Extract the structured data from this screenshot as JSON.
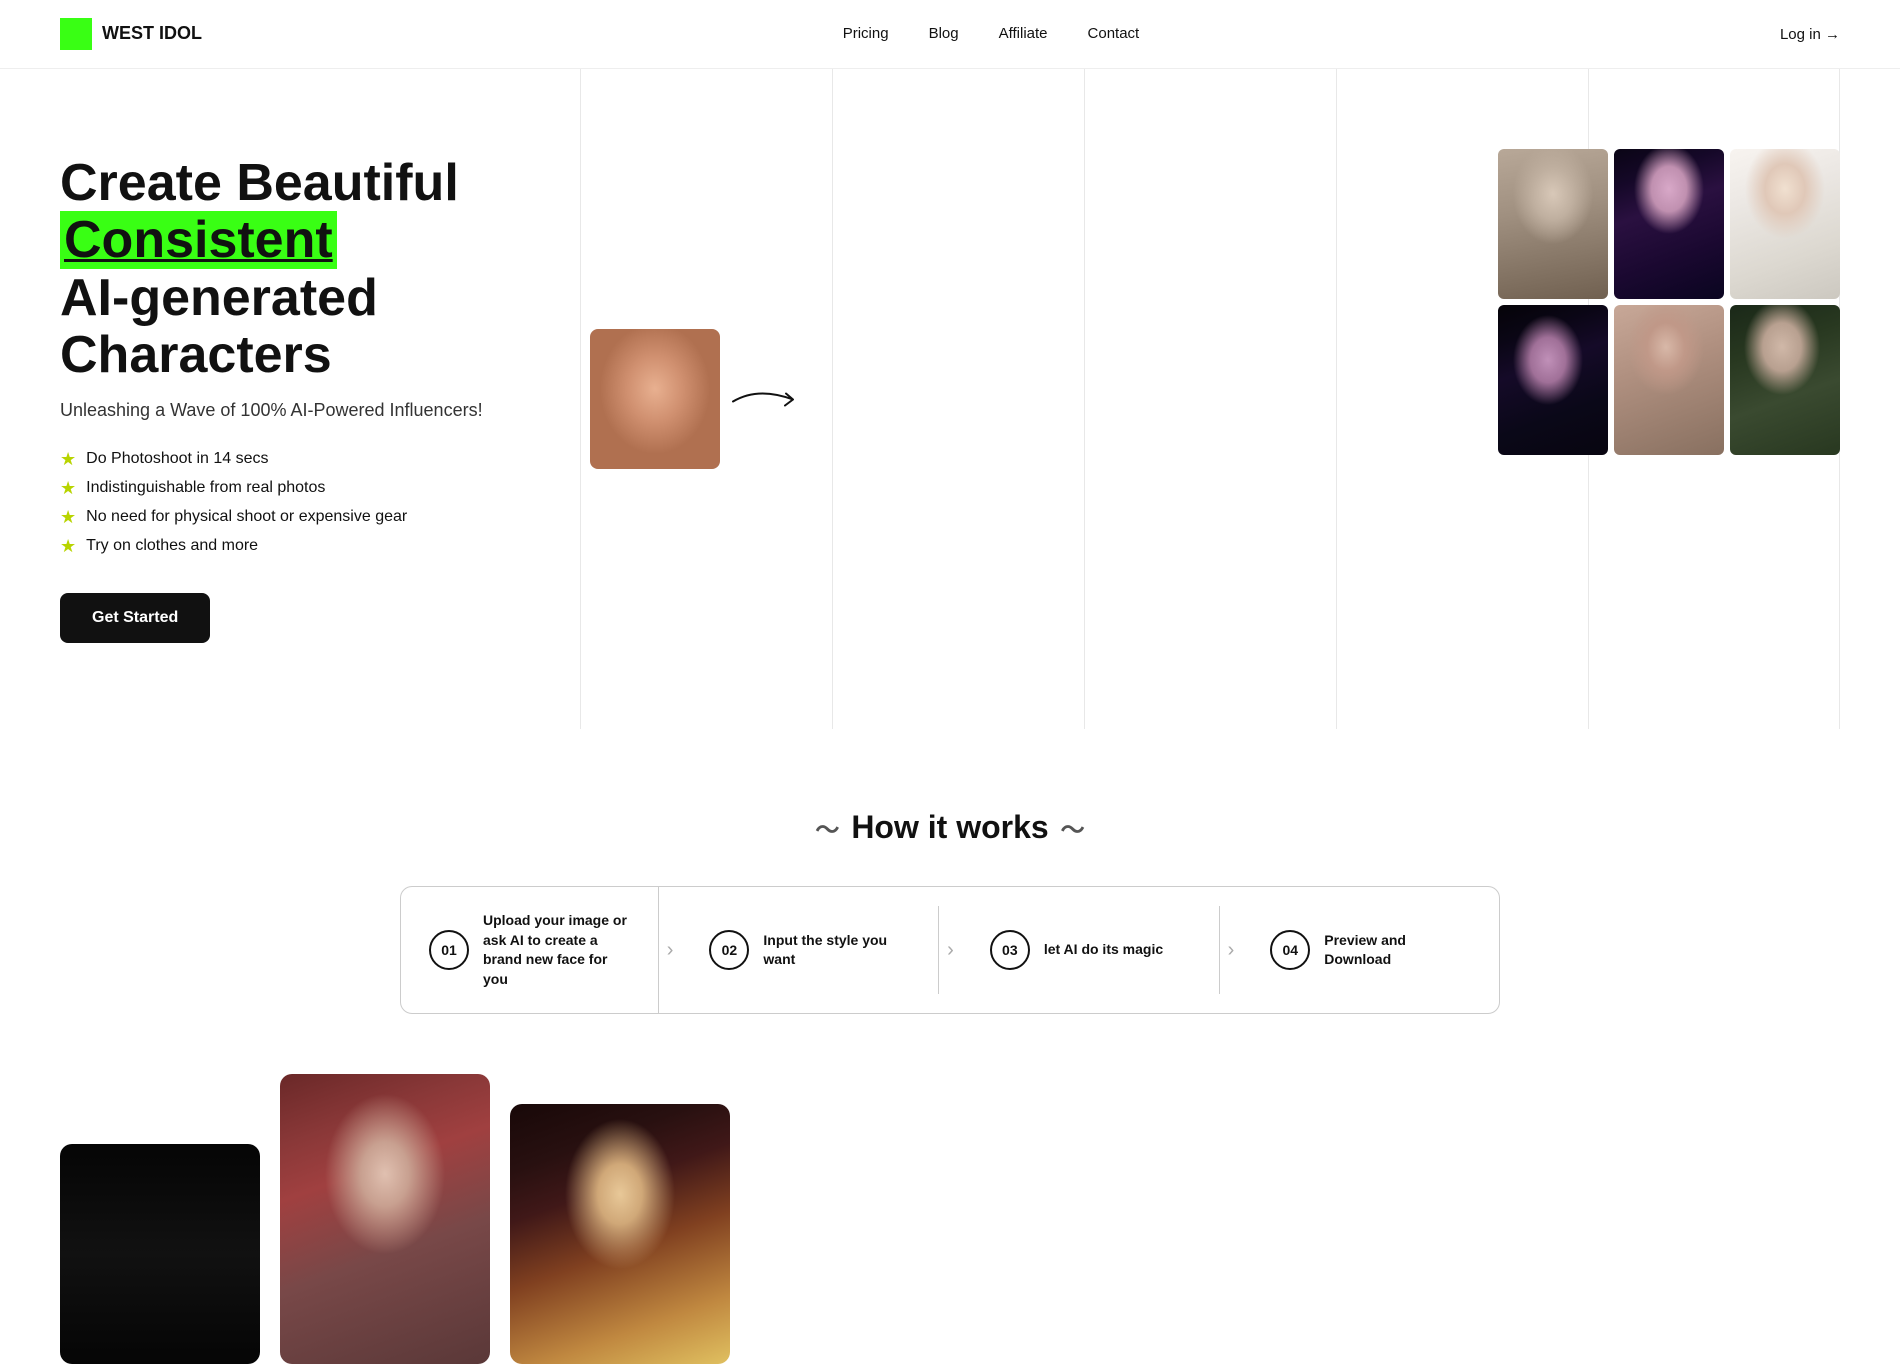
{
  "brand": {
    "name": "WEST IDOL",
    "logo_alt": "West Idol Logo"
  },
  "nav": {
    "links": [
      {
        "label": "Pricing",
        "href": "#"
      },
      {
        "label": "Blog",
        "href": "#"
      },
      {
        "label": "Affiliate",
        "href": "#"
      },
      {
        "label": "Contact",
        "href": "#"
      }
    ],
    "login": "Log in →"
  },
  "hero": {
    "title_prefix": "Create Beautiful",
    "title_highlight": "Consistent",
    "title_suffix": "AI-generated Characters",
    "subtitle": "Unleashing a Wave of 100% AI-Powered Influencers!",
    "features": [
      "Do Photoshoot in 14 secs",
      "Indistinguishable from real photos",
      "No need for physical shoot or expensive gear",
      "Try on clothes and more"
    ],
    "cta": "Get Started"
  },
  "how_it_works": {
    "title": "How it works",
    "steps": [
      {
        "num": "01",
        "text": "Upload your image or ask AI to create a brand new face for you"
      },
      {
        "num": "02",
        "text": "Input the style you want"
      },
      {
        "num": "03",
        "text": "let AI do its magic"
      },
      {
        "num": "04",
        "text": "Preview and Download"
      }
    ]
  },
  "colors": {
    "green": "#39ff14",
    "dark": "#111111",
    "border": "#cccccc"
  }
}
